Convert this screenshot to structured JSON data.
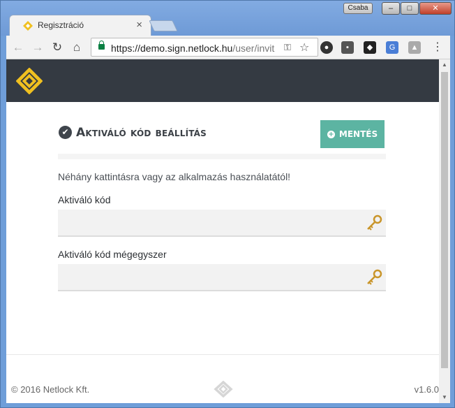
{
  "browser": {
    "tab_title": "Regisztráció",
    "user_name": "Csaba",
    "url_host": "https://demo.sign.netlock.hu",
    "url_path": "/user/invit"
  },
  "page": {
    "title": "Aktiváló kód beállítás",
    "save_label": "MENTÉS",
    "hint": "Néhány kattintásra vagy az alkalmazás használatától!",
    "field1_label": "Aktiváló kód",
    "field1_value": "",
    "field2_label": "Aktiváló kód mégegyszer",
    "field2_value": ""
  },
  "footer": {
    "copyright": "© 2016 Netlock Kft.",
    "version": "v1.6.0"
  },
  "colors": {
    "header_bg": "#343a42",
    "save_button": "#5cb4a2",
    "logo": "#f0c020",
    "secure_lock": "#0b8043"
  },
  "icons": {
    "page_title": "check-circle-icon",
    "save": "plus-circle-icon",
    "fields": "key-icon"
  }
}
